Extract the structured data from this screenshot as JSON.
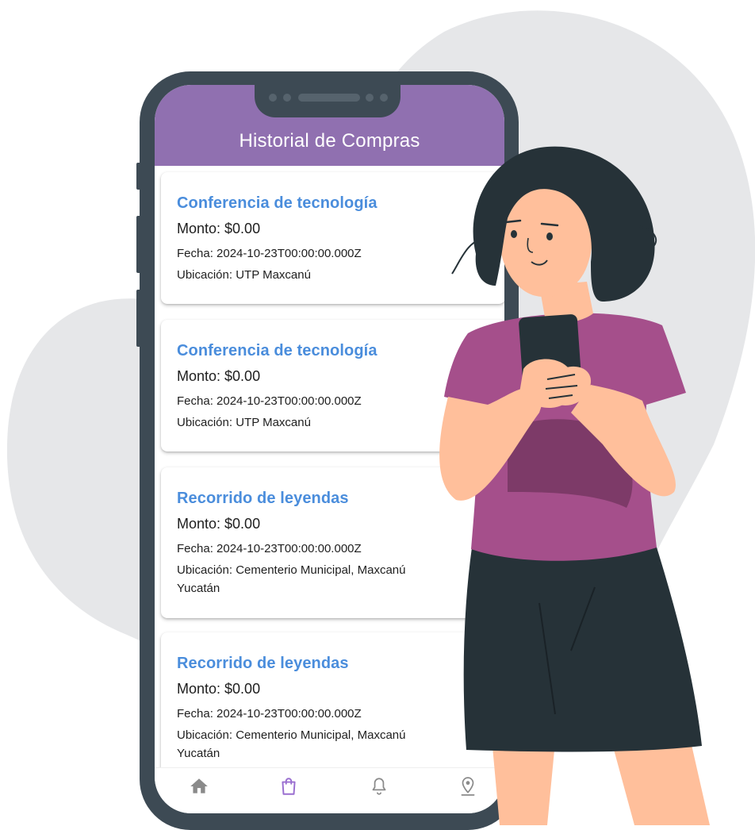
{
  "app": {
    "header_title": "Historial de Compras"
  },
  "purchases": [
    {
      "title": "Conferencia de tecnología",
      "amount": "Monto: $0.00",
      "date": "Fecha: 2024-10-23T00:00:00.000Z",
      "location": "Ubicación: UTP Maxcanú"
    },
    {
      "title": "Conferencia de tecnología",
      "amount": "Monto: $0.00",
      "date": "Fecha: 2024-10-23T00:00:00.000Z",
      "location": "Ubicación: UTP Maxcanú"
    },
    {
      "title": "Recorrido de leyendas",
      "amount": "Monto: $0.00",
      "date": "Fecha: 2024-10-23T00:00:00.000Z",
      "location": "Ubicación: Cementerio Municipal, Maxcanú Yucatán"
    },
    {
      "title": "Recorrido de leyendas",
      "amount": "Monto: $0.00",
      "date": "Fecha: 2024-10-23T00:00:00.000Z",
      "location": "Ubicación: Cementerio Municipal, Maxcanú Yucatán"
    }
  ],
  "bottom_nav": [
    {
      "icon": "home-icon",
      "active": false
    },
    {
      "icon": "shopping-bag-icon",
      "active": true
    },
    {
      "icon": "bell-icon",
      "active": false
    },
    {
      "icon": "location-pin-icon",
      "active": false
    }
  ],
  "colors": {
    "header": "#9070b0",
    "title": "#4a8ddc",
    "nav_active": "#9a6fd0",
    "nav_inactive": "#8a8a8a",
    "phone_frame": "#3d4a54"
  }
}
